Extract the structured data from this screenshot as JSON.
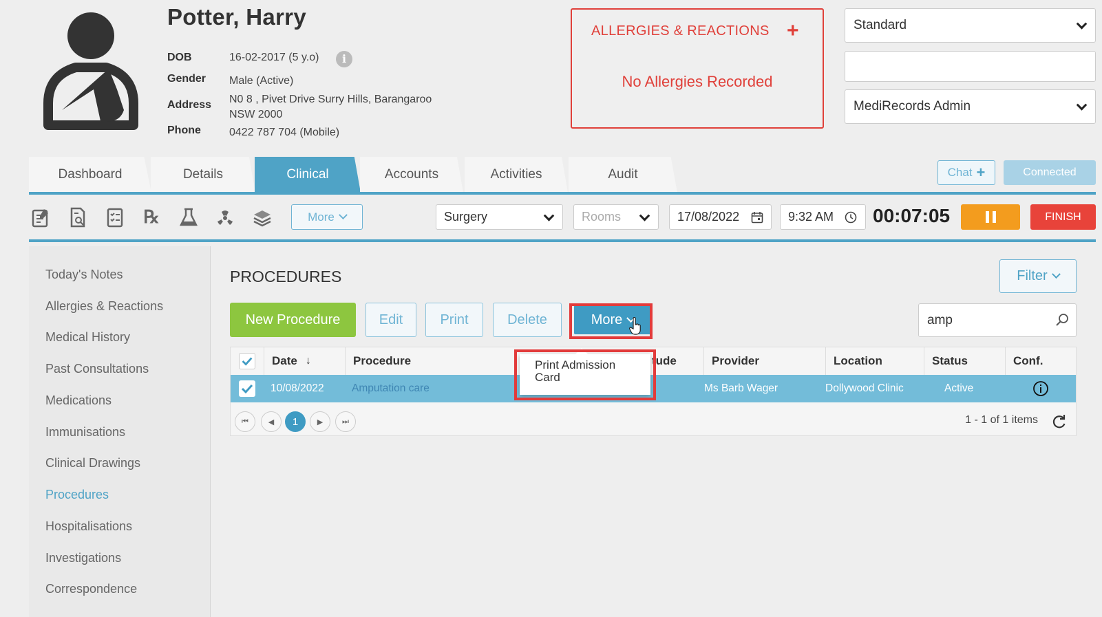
{
  "patient": {
    "name": "Potter, Harry",
    "dob_label": "DOB",
    "dob": "16-02-2017 (5 y.o)",
    "gender_label": "Gender",
    "gender": "Male (Active)",
    "address_label": "Address",
    "address_line1": "N0 8 , Pivet Drive Surry Hills, Barangaroo",
    "address_line2": "NSW 2000",
    "phone_label": "Phone",
    "phone": "0422 787 704 (Mobile)"
  },
  "allergies": {
    "title": "ALLERGIES & REACTIONS",
    "empty_text": "No Allergies Recorded"
  },
  "header_selects": {
    "view": "Standard",
    "blank": "",
    "user": "MediRecords Admin"
  },
  "tabs": [
    {
      "label": "Dashboard"
    },
    {
      "label": "Details"
    },
    {
      "label": "Clinical"
    },
    {
      "label": "Accounts"
    },
    {
      "label": "Activities"
    },
    {
      "label": "Audit"
    }
  ],
  "chat": {
    "label": "Chat",
    "status": "Connected"
  },
  "toolbar": {
    "more_label": "More",
    "location": "Surgery",
    "rooms_placeholder": "Rooms",
    "date": "17/08/2022",
    "time": "9:32 AM",
    "timer": "00:07:05",
    "finish_label": "FINISH",
    "icons": [
      "notes-icon",
      "document-search-icon",
      "checklist-icon",
      "prescription-icon",
      "lab-flask-icon",
      "radiation-icon",
      "stack-icon"
    ]
  },
  "sidebar": {
    "items": [
      {
        "label": "Today's Notes"
      },
      {
        "label": "Allergies & Reactions"
      },
      {
        "label": "Medical History"
      },
      {
        "label": "Past Consultations"
      },
      {
        "label": "Medications"
      },
      {
        "label": "Immunisations"
      },
      {
        "label": "Clinical Drawings"
      },
      {
        "label": "Procedures"
      },
      {
        "label": "Hospitalisations"
      },
      {
        "label": "Investigations"
      },
      {
        "label": "Correspondence"
      }
    ]
  },
  "procedures": {
    "title": "PROCEDURES",
    "filter_label": "Filter",
    "new_label": "New Procedure",
    "edit_label": "Edit",
    "print_label": "Print",
    "delete_label": "Delete",
    "more_label": "More",
    "search_value": "amp",
    "columns": [
      "Date",
      "Procedure",
      "tude",
      "Provider",
      "Location",
      "Status",
      "Conf."
    ],
    "rows": [
      {
        "date": "10/08/2022",
        "procedure": "Amputation care",
        "provider": "Ms Barb Wager",
        "location": "Dollywood Clinic",
        "status": "Active"
      }
    ],
    "page": "1",
    "items_summary": "1 - 1 of 1 items",
    "menu_item": "Print Admission Card"
  },
  "colors": {
    "accent": "#4fa3c6",
    "alert": "#e0403a",
    "green": "#8dc63f",
    "orange": "#f39c1e",
    "highlight": "#e23b3b"
  }
}
